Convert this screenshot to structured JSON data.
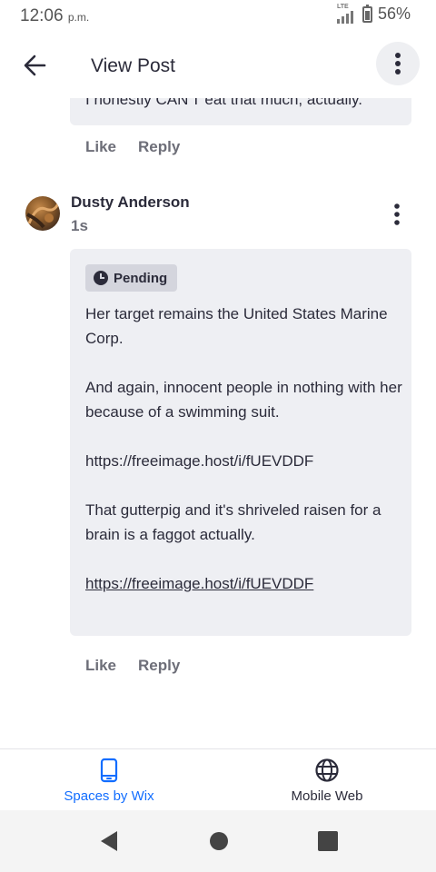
{
  "status_bar": {
    "time": "12:06",
    "ampm": "p.m.",
    "network": "LTE",
    "battery": "56%"
  },
  "header": {
    "title": "View Post"
  },
  "previous_comment": {
    "partial_text": "I honestly CAN'T eat that much, actually.",
    "like_label": "Like",
    "reply_label": "Reply"
  },
  "comment": {
    "author": "Dusty Anderson",
    "timestamp": "1s",
    "status_badge": "Pending",
    "paragraphs": [
      "Her target remains the United States Marine Corp.",
      "And again, innocent people in nothing with her because of a swimming suit.",
      "https://freeimage.host/i/fUEVDDF",
      "That gutterpig and it's shriveled raisen for a brain is a faggot actually."
    ],
    "link": "https://freeimage.host/i/fUEVDDF",
    "like_label": "Like",
    "reply_label": "Reply"
  },
  "bottom_tabs": [
    {
      "label": "Spaces by Wix",
      "icon": "phone-icon",
      "active": true
    },
    {
      "label": "Mobile Web",
      "icon": "globe-icon",
      "active": false
    }
  ],
  "colors": {
    "accent": "#116dff",
    "text": "#2b2b3a",
    "muted": "#6d6e78",
    "bubble": "#eeeff3"
  }
}
